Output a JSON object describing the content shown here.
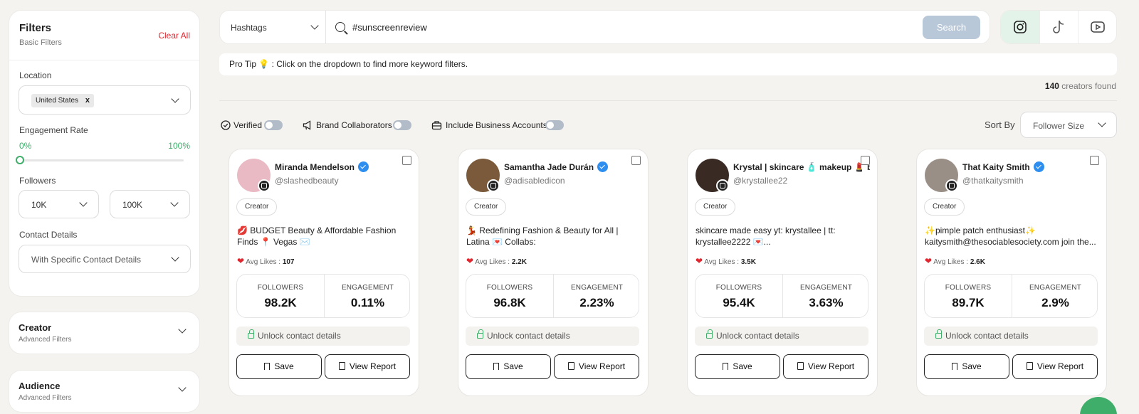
{
  "filters": {
    "title": "Filters",
    "subtitle": "Basic Filters",
    "clear_all": "Clear All",
    "location": {
      "label": "Location",
      "chip": "United States",
      "chip_remove": "x"
    },
    "engagement": {
      "label": "Engagement Rate",
      "min": "0%",
      "max": "100%"
    },
    "followers": {
      "label": "Followers",
      "min": "10K",
      "max": "100K"
    },
    "contact": {
      "label": "Contact Details",
      "value": "With Specific Contact Details"
    }
  },
  "advanced": [
    {
      "title": "Creator",
      "subtitle": "Advanced Filters"
    },
    {
      "title": "Audience",
      "subtitle": "Advanced Filters"
    }
  ],
  "search": {
    "type": "Hashtags",
    "query": "#sunscreenreview",
    "button": "Search"
  },
  "platforms": {
    "active": "instagram",
    "items": [
      "instagram-icon",
      "tiktok-icon",
      "youtube-icon"
    ]
  },
  "protip": "Pro Tip 💡 :  Click on the dropdown to find more keyword filters.",
  "results": {
    "count": "140",
    "suffix": "creators found"
  },
  "toggles": {
    "verified": "Verified",
    "brand": "Brand Collaborators",
    "business": "Include Business Accounts"
  },
  "sort": {
    "label": "Sort By",
    "value": "Follower Size"
  },
  "card_labels": {
    "followers": "FOLLOWERS",
    "engagement": "ENGAGEMENT",
    "avg_likes": "Avg Likes :",
    "unlock": "Unlock contact details",
    "save": "Save",
    "report": "View Report"
  },
  "creators": [
    {
      "name": "Miranda Mendelson",
      "handle": "@slashedbeauty",
      "role": "Creator",
      "bio": "💋 BUDGET Beauty & Affordable Fashion Finds 📍 Vegas ✉️ miranda@slashedbeauty.com",
      "avg_likes": "107",
      "followers": "98.2K",
      "engagement": "0.11%",
      "avatar_color": "#e9b9c4"
    },
    {
      "name": "Samantha Jade Durán",
      "handle": "@adisabledicon",
      "role": "Creator",
      "bio": "💃 Redefining Fashion & Beauty for All | Latina 💌 Collabs: ADisabledIcon@EPTalent.com",
      "avg_likes": "2.2K",
      "followers": "96.8K",
      "engagement": "2.23%",
      "avatar_color": "#7a5a3a"
    },
    {
      "name": "Krystal | skincare 🧴 makeup 💄 beau",
      "handle": "@krystallee22",
      "role": "Creator",
      "bio": "skincare made easy yt: krystallee | tt: krystallee2222 💌...",
      "avg_likes": "3.5K",
      "followers": "95.4K",
      "engagement": "3.63%",
      "avatar_color": "#3a2a24"
    },
    {
      "name": "That Kaity Smith",
      "handle": "@thatkaitysmith",
      "role": "Creator",
      "bio": "✨pimple patch enthusiast✨ kaitysmith@thesociablesociety.com join the...",
      "avg_likes": "2.6K",
      "followers": "89.7K",
      "engagement": "2.9%",
      "avatar_color": "#9a8f86"
    }
  ]
}
